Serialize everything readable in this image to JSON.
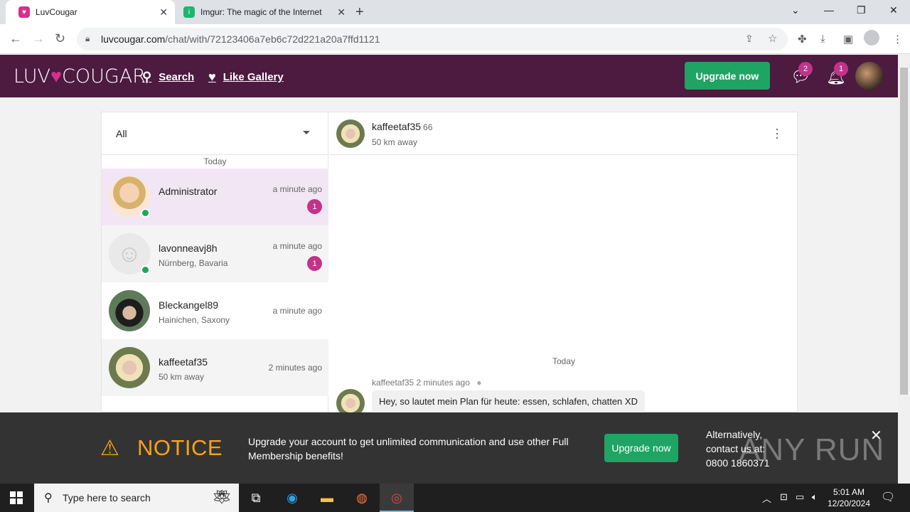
{
  "browser": {
    "tabs": [
      {
        "title": "LuvCougar",
        "active": true
      },
      {
        "title": "Imgur: The magic of the Internet",
        "active": false
      }
    ],
    "url_host": "luvcougar.com",
    "url_path": "/chat/with/72123406a7eb6c72d221a20a7ffd1121"
  },
  "header": {
    "logo_left": "LUV",
    "logo_right": "COUGAR",
    "search_label": "Search",
    "gallery_label": "Like Gallery",
    "upgrade_label": "Upgrade now",
    "messages_badge": "2",
    "notifications_badge": "1"
  },
  "sidebar": {
    "filter_value": "All",
    "day_label": "Today",
    "conversations": [
      {
        "name": "Administrator",
        "location": "",
        "time": "a minute ago",
        "badge": "1",
        "online": true
      },
      {
        "name": "lavonneavj8h",
        "location": "Nürnberg, Bavaria",
        "time": "a minute ago",
        "badge": "1",
        "online": true
      },
      {
        "name": "Bleckangel89",
        "location": "Hainichen, Saxony",
        "time": "a minute ago",
        "badge": "",
        "online": false
      },
      {
        "name": "kaffeetaf35",
        "location": "50 km away",
        "time": "2 minutes ago",
        "badge": "",
        "online": false
      }
    ]
  },
  "chat": {
    "name": "kaffeetaf35",
    "age": "66",
    "distance": "50 km away",
    "day_label": "Today",
    "message_meta": "kaffeetaf35 2 minutes ago",
    "message_text": "Hey, so lautet mein Plan für heute: essen, schlafen, chatten XD"
  },
  "notice": {
    "title": "NOTICE",
    "text": "Upgrade your account to get unlimited communication and use other Full Membership benefits!",
    "button": "Upgrade now",
    "alt_line1": "Alternatively,",
    "alt_line2": "contact us at:",
    "alt_line3": "0800 1860371",
    "watermark": "ANY RUN"
  },
  "taskbar": {
    "search_placeholder": "Type here to search",
    "time": "5:01 AM",
    "date": "12/20/2024"
  },
  "colors": {
    "header_bg": "#4d1a40",
    "accent_pink": "#c2338a",
    "green": "#1fa463",
    "notice_orange": "#f7a21b"
  }
}
